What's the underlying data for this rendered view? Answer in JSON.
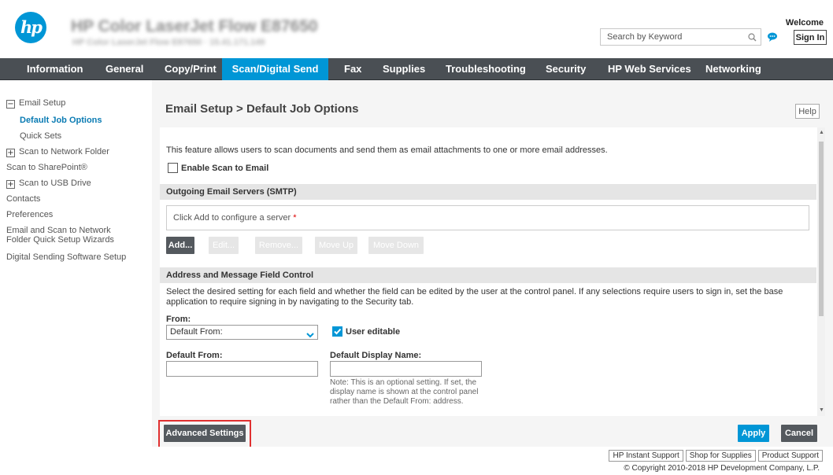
{
  "header": {
    "logo_text": "hp",
    "device_name": "HP Color LaserJet Flow E87650",
    "device_info": "HP Color LaserJet Flow E87650 · 15.41.171.149",
    "search_placeholder": "Search by Keyword",
    "welcome": "Welcome",
    "sign_in": "Sign In"
  },
  "nav": {
    "tabs": [
      {
        "label": "Information"
      },
      {
        "label": "General"
      },
      {
        "label": "Copy/Print"
      },
      {
        "label": "Scan/Digital Send",
        "active": true
      },
      {
        "label": "Fax"
      },
      {
        "label": "Supplies"
      },
      {
        "label": "Troubleshooting"
      },
      {
        "label": "Security"
      },
      {
        "label": "HP Web Services"
      },
      {
        "label": "Networking"
      }
    ]
  },
  "sidebar": {
    "items": [
      {
        "label": "Email Setup",
        "toggle": "−"
      },
      {
        "label": "Default Job Options",
        "active": true
      },
      {
        "label": "Quick Sets"
      },
      {
        "label": "Scan to Network Folder",
        "toggle": "+"
      },
      {
        "label": "Scan to SharePoint®"
      },
      {
        "label": "Scan to USB Drive",
        "toggle": "+"
      },
      {
        "label": "Contacts"
      },
      {
        "label": "Preferences"
      },
      {
        "label": "Email and Scan to Network"
      },
      {
        "label": "Folder Quick Setup Wizards"
      },
      {
        "label": "Digital Sending Software Setup"
      }
    ]
  },
  "main": {
    "title": "Email Setup > Default Job Options",
    "help": "Help",
    "description": "This feature allows users to scan documents and send them as email attachments to one or more email addresses.",
    "enable_label": "Enable Scan to Email",
    "smtp_header": "Outgoing Email Servers (SMTP)",
    "server_placeholder": "Click Add to configure a server",
    "required_marker": "*",
    "server_buttons": {
      "add": "Add...",
      "edit": "Edit...",
      "remove": "Remove...",
      "move_up": "Move Up",
      "move_down": "Move Down"
    },
    "address_header": "Address and Message Field Control",
    "address_paragraph": "Select the desired setting for each field and whether the field can be edited by the user at the control panel. If any selections require users to sign in, set the base application to require signing in by navigating to the Security tab.",
    "from_label": "From:",
    "from_value": "Default From:",
    "user_editable": "User editable",
    "user_editable_checked": true,
    "default_from_label": "Default From:",
    "default_from_value": "",
    "display_name_label": "Default Display Name:",
    "display_name_value": "",
    "note": "Note: This is an optional setting. If set, the display name is shown at the control panel rather than the Default From: address."
  },
  "footer": {
    "advanced": "Advanced Settings",
    "apply": "Apply",
    "cancel": "Cancel"
  },
  "bottom": {
    "links": [
      "HP Instant Support",
      "Shop for Supplies",
      "Product Support"
    ],
    "copyright": "© Copyright 2010-2018 HP Development Company, L.P."
  },
  "colors": {
    "accent": "#0096d6",
    "nav_bg": "#4a4f54",
    "highlight": "#e03030"
  }
}
